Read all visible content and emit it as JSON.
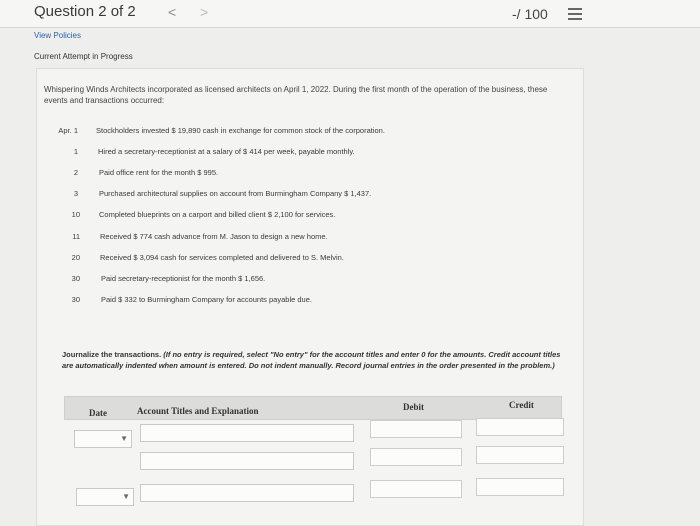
{
  "header": {
    "question": "Question 2 of 2",
    "prev_arrow": "<",
    "next_arrow": ">",
    "score": "-/ 100"
  },
  "links": {
    "view_policies": "View Policies"
  },
  "status": {
    "attempt": "Current Attempt in Progress"
  },
  "problem": {
    "intro": "Whispering Winds Architects incorporated as licensed architects on April 1, 2022. During the first month of the operation of the business, these events and transactions occurred:",
    "events": [
      {
        "day": "Apr. 1",
        "desc": "Stockholders invested $ 19,890 cash in exchange for common stock of the corporation."
      },
      {
        "day": "1",
        "desc": "Hired a secretary-receptionist at a salary of $ 414 per week, payable monthly."
      },
      {
        "day": "2",
        "desc": "Paid office rent for the month $ 995."
      },
      {
        "day": "3",
        "desc": "Purchased architectural supplies on account from Burmingham Company $ 1,437."
      },
      {
        "day": "10",
        "desc": "Completed blueprints on a carport and billed client $ 2,100 for services."
      },
      {
        "day": "11",
        "desc": "Received $ 774 cash advance from M. Jason to design a new home."
      },
      {
        "day": "20",
        "desc": "Received $ 3,094 cash for services completed and delivered to S. Melvin."
      },
      {
        "day": "30",
        "desc": "Paid secretary-receptionist for the month $ 1,656."
      },
      {
        "day": "30",
        "desc": "Paid $ 332 to Burmingham Company for accounts payable due."
      }
    ]
  },
  "instruction": {
    "main": "Journalize the transactions.",
    "note": "(If no entry is required, select \"No entry\" for the account titles and enter 0 for the amounts. Credit account titles are automatically indented when amount is entered. Do not indent manually. Record journal entries in the order presented in the problem.)"
  },
  "journal": {
    "headers": {
      "date": "Date",
      "account": "Account Titles and Explanation",
      "debit": "Debit",
      "credit": "Credit"
    }
  },
  "icons": {
    "list": "list-icon",
    "select": "chevron-down-icon"
  }
}
